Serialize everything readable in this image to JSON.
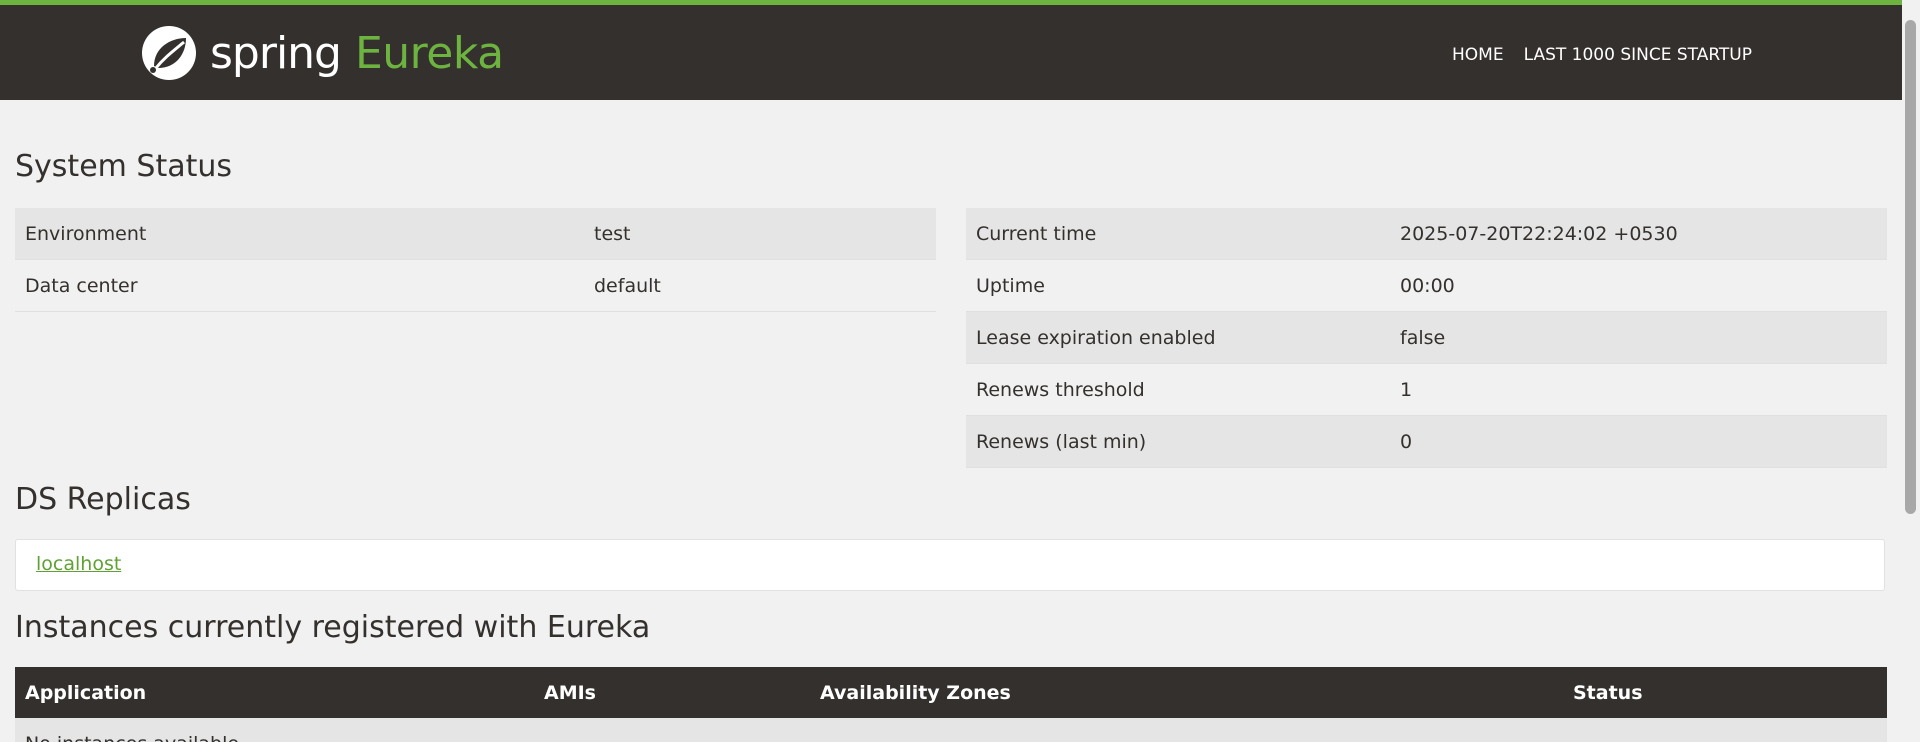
{
  "brand": {
    "spring": "spring",
    "eureka": "Eureka"
  },
  "nav": {
    "home": "HOME",
    "last": "LAST 1000 SINCE STARTUP"
  },
  "system_status": {
    "title": "System Status",
    "left": [
      {
        "k": "Environment",
        "v": "test"
      },
      {
        "k": "Data center",
        "v": "default"
      }
    ],
    "right": [
      {
        "k": "Current time",
        "v": "2025-07-20T22:24:02 +0530"
      },
      {
        "k": "Uptime",
        "v": "00:00"
      },
      {
        "k": "Lease expiration enabled",
        "v": "false"
      },
      {
        "k": "Renews threshold",
        "v": "1"
      },
      {
        "k": "Renews (last min)",
        "v": "0"
      }
    ]
  },
  "ds_replicas": {
    "title": "DS Replicas",
    "link": "localhost"
  },
  "instances": {
    "title": "Instances currently registered with Eureka",
    "headers": [
      "Application",
      "AMIs",
      "Availability Zones",
      "Status"
    ],
    "empty": "No instances available"
  },
  "colors": {
    "accent": "#6db33f",
    "dark": "#34302d"
  }
}
